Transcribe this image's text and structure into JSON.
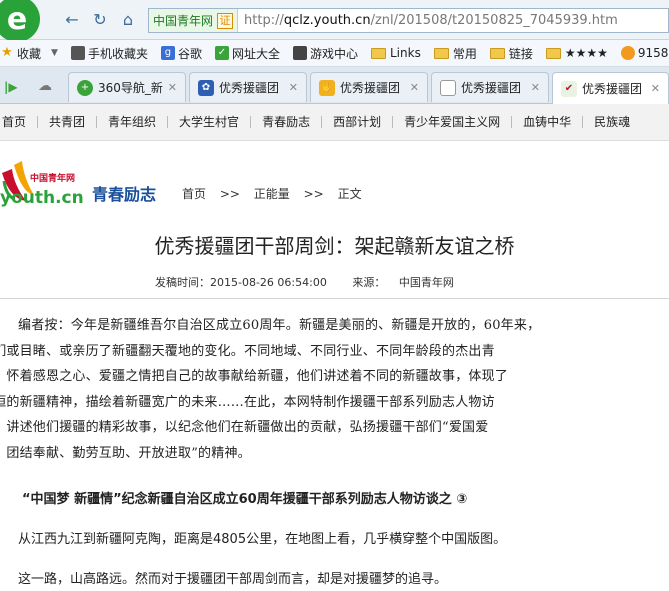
{
  "browser": {
    "address": {
      "site_name": "中国青年网",
      "cert_glyph": "证",
      "url_scheme": "http://",
      "url_host": "qclz.youth.cn",
      "url_path": "/znl/201508/t20150825_7045939.htm"
    },
    "favorites": [
      {
        "label": "收藏",
        "icon": "star-icon"
      },
      {
        "label": "手机收藏夹",
        "icon": "phone-icon"
      },
      {
        "label": "谷歌",
        "icon": "google-icon"
      },
      {
        "label": "网址大全",
        "icon": "shield-icon"
      },
      {
        "label": "游戏中心",
        "icon": "gamepad-icon"
      },
      {
        "label": "Links",
        "icon": "folder-icon"
      },
      {
        "label": "常用",
        "icon": "folder-icon"
      },
      {
        "label": "链接",
        "icon": "folder-icon"
      },
      {
        "label": "★★★★",
        "icon": "folder-icon"
      },
      {
        "label": "9158",
        "icon": "face-icon"
      }
    ],
    "tabs": [
      {
        "label": "360导航_新",
        "icon": "plus-icon"
      },
      {
        "label": "优秀援疆团",
        "icon": "paw-icon"
      },
      {
        "label": "优秀援疆团",
        "icon": "hand-icon"
      },
      {
        "label": "优秀援疆团",
        "icon": "page-icon"
      },
      {
        "label": "优秀援疆团",
        "icon": "youth-icon"
      }
    ]
  },
  "top_nav": [
    "首页",
    "共青团",
    "青年组织",
    "大学生村官",
    "青春励志",
    "西部计划",
    "青少年爱国主义网",
    "血铸中华",
    "民族魂"
  ],
  "site": {
    "logo_cn": "中国青年网",
    "logo_domain": "youth.cn",
    "channel": "青春励志"
  },
  "breadcrumb": [
    "首页",
    ">>",
    "正能量",
    ">>",
    "正文"
  ],
  "article": {
    "title": "优秀援疆团干部周剑：架起赣新友谊之桥",
    "date_label": "发稿时间：2015-08-26 06:54:00",
    "source_label": "来源：",
    "source": "中国青年网",
    "editor_lines": [
      "编者按：今年是新疆维吾尔自治区成立60周年。新疆是美丽的、新疆是开放的，60年来，",
      "我们或目睹、或亲历了新疆翻天覆地的变化。不同地域、不同行业、不同年龄段的杰出青",
      "年，怀着感恩之心、爱疆之情把自己的故事献给新疆，他们讲述着不同的新疆故事，体现了",
      "永恒的新疆精神，描绘着新疆宽广的未来……在此，本网特制作援疆干部系列励志人物访",
      "谈，讲述他们援疆的精彩故事，以纪念他们在新疆做出的贡献，弘扬援疆干部们“爱国爱",
      "疆、团结奉献、勤劳互助、开放进取”的精神。"
    ],
    "series_title": "“中国梦 新疆情”纪念新疆自治区成立60周年援疆干部系列励志人物访谈之 ③",
    "body": [
      "从江西九江到新疆阿克陶，距离是4805公里，在地图上看，几乎横穿整个中国版图。",
      "这一路，山高路远。然而对于援疆团干部周剑而言，却是对援疆梦的追寻。"
    ]
  }
}
